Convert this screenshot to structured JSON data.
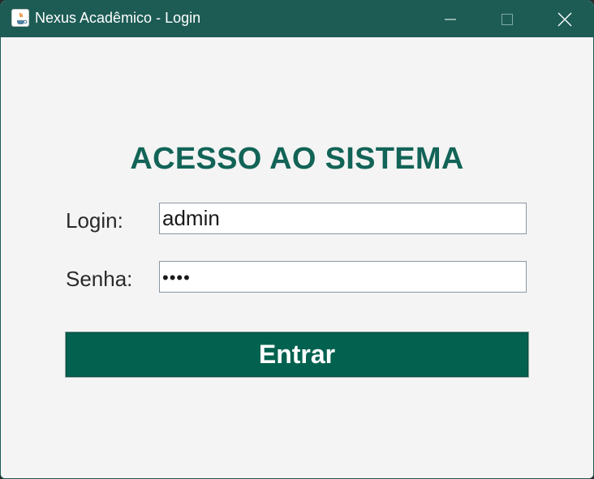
{
  "window": {
    "title": "Nexus Acadêmico - Login",
    "app_icon": "java-coffee-icon",
    "controls": {
      "minimize_icon": "minimize-icon",
      "maximize_icon": "maximize-icon",
      "close_icon": "close-icon"
    }
  },
  "form": {
    "heading": "ACESSO AO SISTEMA",
    "login_label": "Login:",
    "login_value": "admin",
    "password_label": "Senha:",
    "password_mask": "••••",
    "submit_label": "Entrar"
  },
  "colors": {
    "titlebar": "#1d5c55",
    "accent": "#126457",
    "button": "#02624f",
    "background": "#f4f4f4"
  }
}
